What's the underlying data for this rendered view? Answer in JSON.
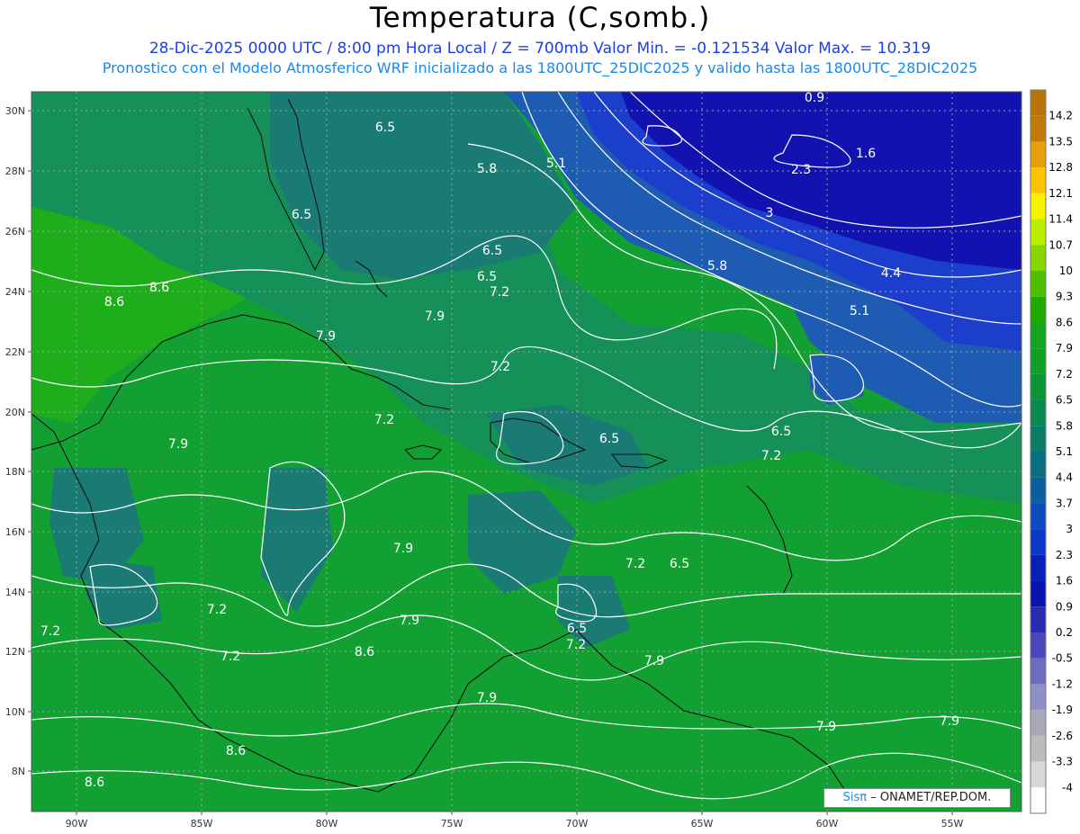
{
  "header": {
    "title": "Temperatura (C,somb.)",
    "line1": "28-Dic-2025   0000 UTC / 8:00 pm Hora Local / Z = 700mb   Valor Min. = -0.121534  Valor Max. = 10.319",
    "line2": "Pronostico con el Modelo Atmosferico WRF inicializado a las 1800UTC_25DIC2025 y valido hasta las  1800UTC_28DIC2025"
  },
  "axes": {
    "lat_labels": [
      "30N",
      "28N",
      "26N",
      "24N",
      "22N",
      "20N",
      "18N",
      "16N",
      "14N",
      "12N",
      "10N",
      "8N"
    ],
    "lon_labels": [
      "90W",
      "85W",
      "80W",
      "75W",
      "70W",
      "65W",
      "60W",
      "55W"
    ]
  },
  "contour_labels": [
    "0.9",
    "1.6",
    "2.3",
    "3",
    "4.4",
    "5.1",
    "5.8",
    "6.5",
    "7.2",
    "7.9",
    "8.6"
  ],
  "colorbar": {
    "labels": [
      "14.2",
      "13.5",
      "12.8",
      "12.1",
      "11.4",
      "10.7",
      "10",
      "9.3",
      "8.6",
      "7.9",
      "7.2",
      "6.5",
      "5.8",
      "5.1",
      "4.4",
      "3.7",
      "3",
      "2.3",
      "1.6",
      "0.9",
      "0.2",
      "-0.5",
      "-1.2",
      "-1.9",
      "-2.6",
      "-3.3",
      "-4"
    ],
    "colors": [
      "#c07a08",
      "#e79e08",
      "#ffc400",
      "#f6f200",
      "#b6f000",
      "#86d800",
      "#4cc000",
      "#20a800",
      "#14a420",
      "#10a028",
      "#0c9438",
      "#0a8850",
      "#0a7c68",
      "#0b6e80",
      "#0c5ea0",
      "#0a4cc0",
      "#0a38c8",
      "#0820b8",
      "#0a12b0",
      "#2a2ab0",
      "#4848b8",
      "#6c6cc0",
      "#9090c8",
      "#a8a8b8",
      "#bcbcbc",
      "#d8d8d8",
      "#ffffff"
    ]
  },
  "map_palette": {
    "darkblue": "#1212b0",
    "blue": "#1c3ecc",
    "midblue": "#1d5cb2",
    "teal": "#1a7a74",
    "tealgreen": "#159058",
    "green": "#12a032",
    "lightgreen": "#1eae1c"
  },
  "credit": {
    "brand": "Sisπ",
    "org": "– ONAMET/REP.DOM."
  }
}
